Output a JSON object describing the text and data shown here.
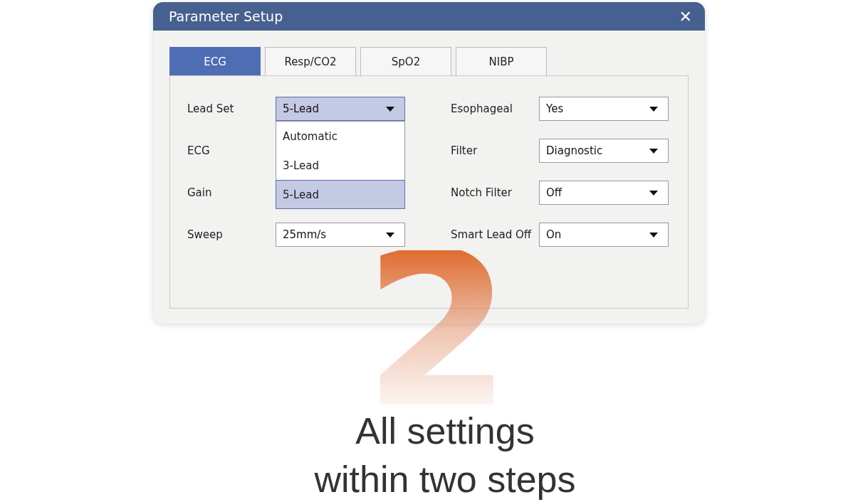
{
  "window": {
    "title": "Parameter Setup",
    "close": "✕"
  },
  "tabs": [
    {
      "label": "ECG",
      "selected": true
    },
    {
      "label": "Resp/CO2",
      "selected": false
    },
    {
      "label": "SpO2",
      "selected": false
    },
    {
      "label": "NIBP",
      "selected": false
    }
  ],
  "left_fields": [
    {
      "label": "Lead Set",
      "value": "5-Lead",
      "open": true,
      "options": [
        {
          "label": "Automatic",
          "selected": false
        },
        {
          "label": "3-Lead",
          "selected": false
        },
        {
          "label": "5-Lead",
          "selected": true
        }
      ]
    },
    {
      "label": "ECG",
      "open": false
    },
    {
      "label": "Gain",
      "open": false
    },
    {
      "label": "Sweep",
      "value": "25mm/s",
      "open": false
    }
  ],
  "right_fields": [
    {
      "label": "Esophageal",
      "value": "Yes",
      "open": false
    },
    {
      "label": "Filter",
      "value": "Diagnostic",
      "open": false
    },
    {
      "label": "Notch Filter",
      "value": "Off",
      "open": false
    },
    {
      "label": "Smart Lead Off",
      "value": "On",
      "open": false
    }
  ],
  "big_number": "2",
  "caption": [
    "All settings",
    "within two steps"
  ]
}
